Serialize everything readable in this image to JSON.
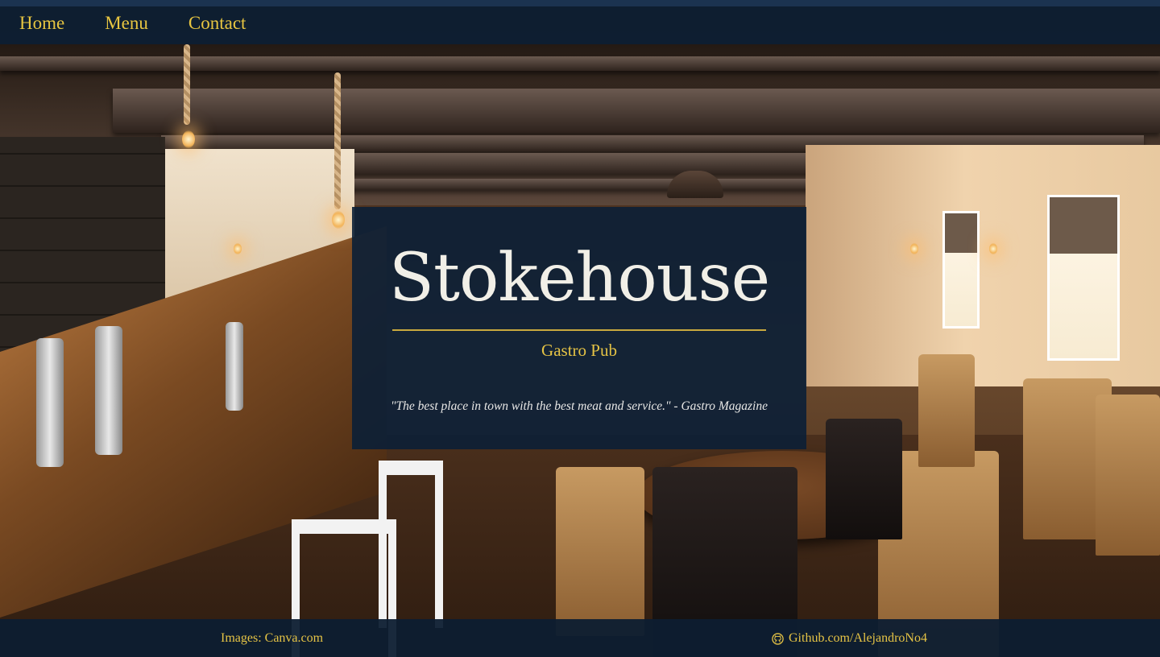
{
  "nav": {
    "items": [
      {
        "label": "Home"
      },
      {
        "label": "Menu"
      },
      {
        "label": "Contact"
      }
    ]
  },
  "hero": {
    "title": "Stokehouse",
    "subtitle": "Gastro Pub",
    "quote": "\"The best place in town with the best meat and service.\" - Gastro Magazine"
  },
  "footer": {
    "images_credit": "Images: Canva.com",
    "github_link": "Github.com/AlejandroNo4",
    "github_icon": "github-icon"
  },
  "colors": {
    "accent": "#e5c345",
    "panel": "#0b1f36",
    "text_light": "#f1efe7"
  }
}
